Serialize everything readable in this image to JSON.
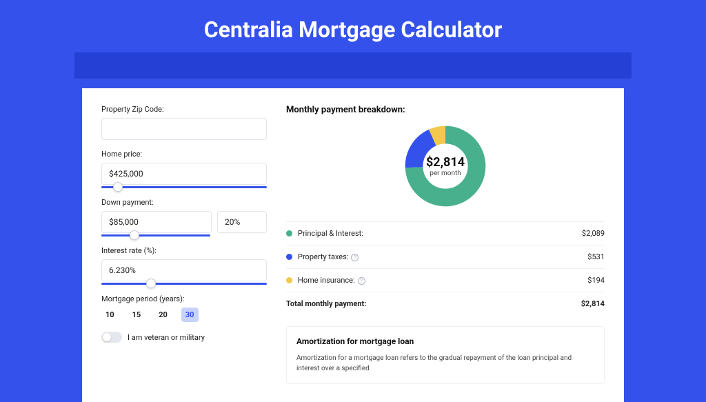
{
  "title": "Centralia Mortgage Calculator",
  "form": {
    "zip": {
      "label": "Property Zip Code:",
      "value": ""
    },
    "homePrice": {
      "label": "Home price:",
      "value": "$425,000",
      "sliderPct": 10
    },
    "down": {
      "label": "Down payment:",
      "amount": "$85,000",
      "pct": "20%",
      "sliderPct": 20
    },
    "rate": {
      "label": "Interest rate (%):",
      "value": "6.230%",
      "sliderPct": 30
    },
    "period": {
      "label": "Mortgage period (years):",
      "options": [
        "10",
        "15",
        "20",
        "30"
      ],
      "active": "30"
    },
    "veteran": {
      "label": "I am veteran or military",
      "on": false
    }
  },
  "breakdown": {
    "title": "Monthly payment breakdown:",
    "centerAmount": "$2,814",
    "centerPer": "per month",
    "rows": [
      {
        "color": "#48b08c",
        "label": "Principal & Interest:",
        "value": "$2,089",
        "info": false
      },
      {
        "color": "#3452eb",
        "label": "Property taxes:",
        "value": "$531",
        "info": true
      },
      {
        "color": "#f2c94c",
        "label": "Home insurance:",
        "value": "$194",
        "info": true
      }
    ],
    "total": {
      "label": "Total monthly payment:",
      "value": "$2,814"
    }
  },
  "amort": {
    "title": "Amortization for mortgage loan",
    "text": "Amortization for a mortgage loan refers to the gradual repayment of the loan principal and interest over a specified"
  },
  "chart_data": {
    "type": "pie",
    "title": "Monthly payment breakdown",
    "categories": [
      "Principal & Interest",
      "Property taxes",
      "Home insurance"
    ],
    "values": [
      2089,
      531,
      194
    ],
    "colors": [
      "#48b08c",
      "#3452eb",
      "#f2c94c"
    ],
    "total": 2814,
    "center_label": "$2,814 per month"
  }
}
